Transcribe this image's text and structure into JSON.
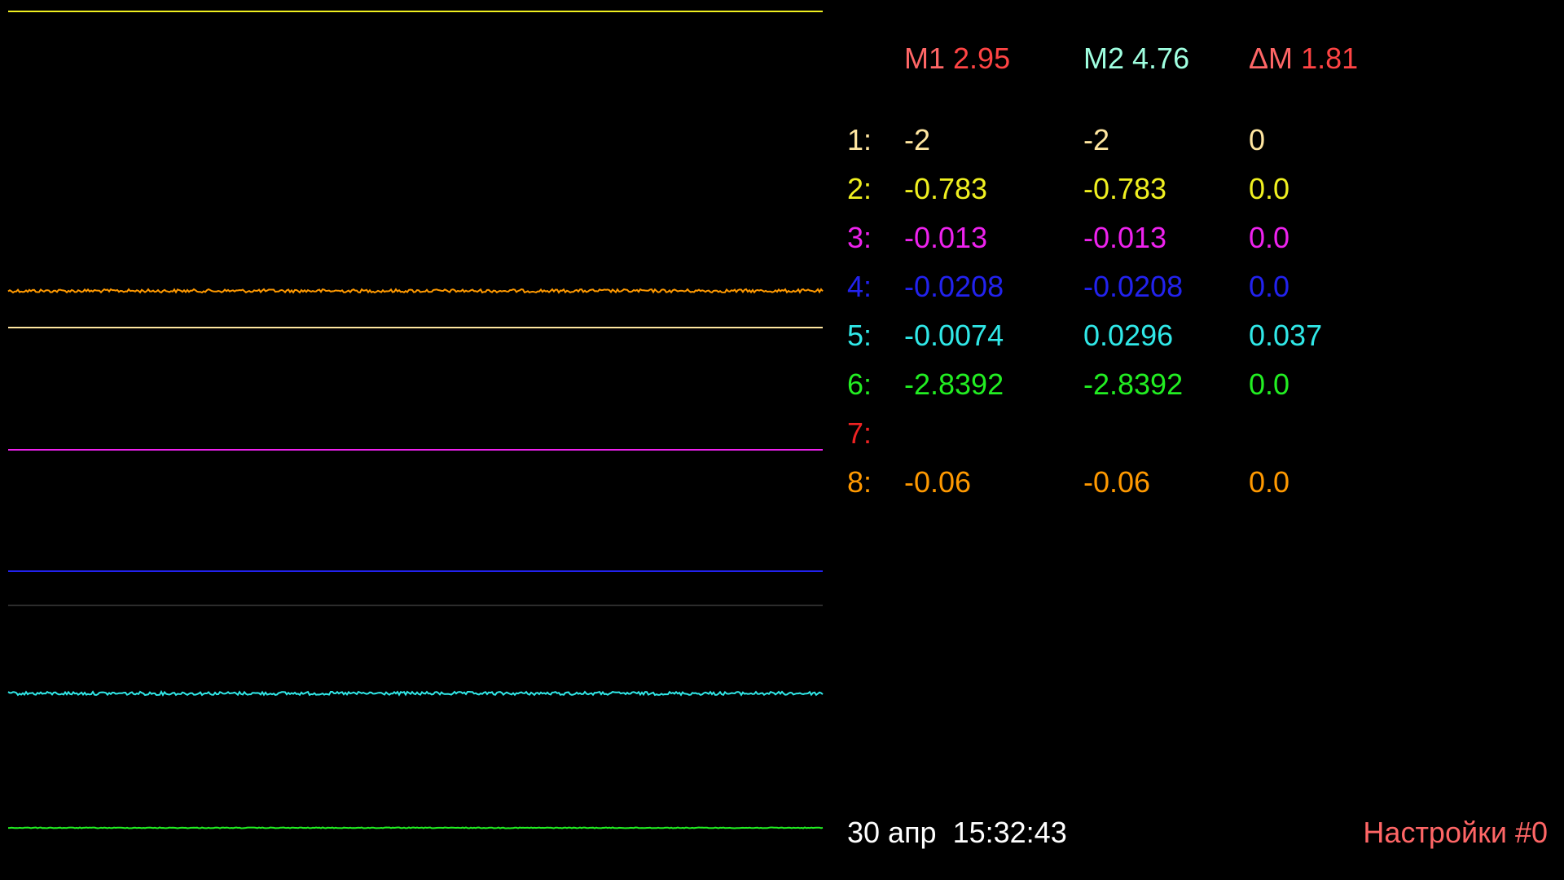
{
  "markers": {
    "m1": {
      "label": "M1",
      "value": "2.95"
    },
    "m2": {
      "label": "M2",
      "value": "4.76"
    },
    "dm": {
      "label": "ΔM",
      "value": "1.81"
    }
  },
  "colors": {
    "m1_label": "#ff6666",
    "m1_value": "#ff4444",
    "m2_label": "#9fffe0",
    "m2_value": "#9fffe0",
    "dm_label": "#ff6666",
    "dm_value": "#ff4444",
    "datetime": "#ffffff",
    "settings": "#ff6666",
    "divider": "#3a3a3a"
  },
  "channels": [
    {
      "index": "1:",
      "m1": "-2",
      "m2": "-2",
      "delta": "0",
      "color": "#ffe6a0"
    },
    {
      "index": "2:",
      "m1": "-0.783",
      "m2": "-0.783",
      "delta": "0.0",
      "color": "#f0f020"
    },
    {
      "index": "3:",
      "m1": "-0.013",
      "m2": "-0.013",
      "delta": "0.0",
      "color": "#ee22ee"
    },
    {
      "index": "4:",
      "m1": "-0.0208",
      "m2": "-0.0208",
      "delta": "0.0",
      "color": "#2222ee"
    },
    {
      "index": "5:",
      "m1": "-0.0074",
      "m2": "0.0296",
      "delta": "0.037",
      "color": "#30e8e8"
    },
    {
      "index": "6:",
      "m1": "-2.8392",
      "m2": "-2.8392",
      "delta": "0.0",
      "color": "#22ee22"
    },
    {
      "index": "7:",
      "m1": "",
      "m2": "",
      "delta": "",
      "color": "#ee2222"
    },
    {
      "index": "8:",
      "m1": "-0.06",
      "m2": "-0.06",
      "delta": "0.0",
      "color": "#ff9900"
    }
  ],
  "traces": [
    {
      "name": "trace-2",
      "color": "#f0f020",
      "noise": 0
    },
    {
      "name": "trace-8",
      "color": "#ff9900",
      "noise": 2
    },
    {
      "name": "trace-1",
      "color": "#ffe6a0",
      "noise": 0
    },
    {
      "name": "trace-3",
      "color": "#ee22ee",
      "noise": 0
    },
    {
      "name": "trace-4",
      "color": "#2222ee",
      "noise": 0
    },
    {
      "name": "trace-5",
      "color": "#30e8e8",
      "noise": 2
    },
    {
      "name": "trace-6",
      "color": "#22ee22",
      "noise": 0.5
    }
  ],
  "datetime": "30 апр  15:32:43",
  "settings": "Настройки #0"
}
